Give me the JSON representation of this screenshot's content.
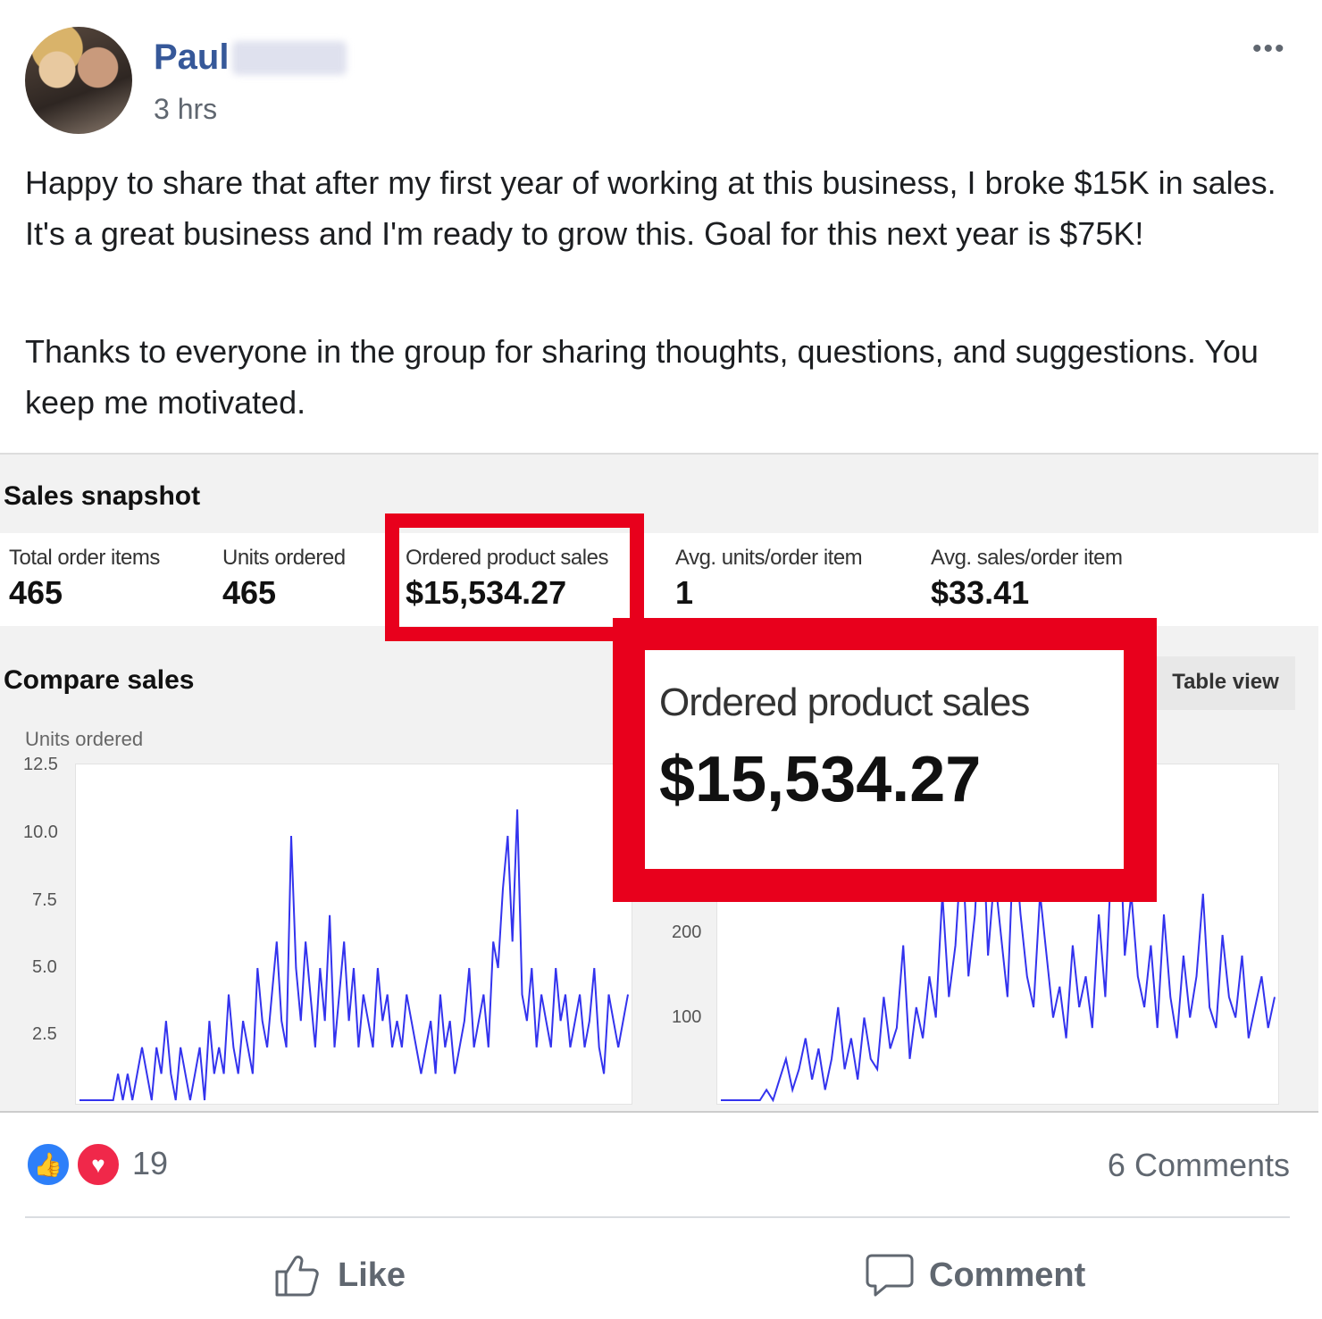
{
  "post": {
    "author": "Paul",
    "time": "3 hrs",
    "more_icon": "•••",
    "paragraphs": [
      "Happy to share that after my first year of working at this business, I broke $15K in sales. It's a great business and I'm ready to grow this. Goal for this next year is $75K!",
      "Thanks to everyone in the group for sharing thoughts, questions, and suggestions. You keep me motivated."
    ]
  },
  "screenshot": {
    "title": "Sales snapshot",
    "metrics": [
      {
        "label": "Total order items",
        "value": "465"
      },
      {
        "label": "Units ordered",
        "value": "465"
      },
      {
        "label": "Ordered product sales",
        "value": "$15,534.27"
      },
      {
        "label": "Avg. units/order item",
        "value": "1"
      },
      {
        "label": "Avg. sales/order item",
        "value": "$33.41"
      }
    ],
    "compare_title": "Compare sales",
    "units_label": "Units ordered",
    "table_view": "Table view",
    "zoom": {
      "label": "Ordered product sales",
      "value": "$15,534.27"
    },
    "highlight_color": "#e8001c"
  },
  "chart_data": [
    {
      "type": "line",
      "ylabel": "Units ordered",
      "ylim": [
        0,
        12.5
      ],
      "yticks": [
        "12.5",
        "10.0",
        "7.5",
        "5.0",
        "2.5"
      ],
      "series_color": "#3333ee",
      "values": [
        0,
        0,
        0,
        0,
        0,
        0,
        0,
        0,
        1,
        0,
        1,
        0,
        1,
        2,
        1,
        0,
        2,
        1,
        3,
        1,
        0,
        2,
        1,
        0,
        1,
        2,
        0,
        3,
        1,
        2,
        1,
        4,
        2,
        1,
        3,
        2,
        1,
        5,
        3,
        2,
        4,
        6,
        3,
        2,
        10,
        5,
        3,
        6,
        4,
        2,
        5,
        3,
        7,
        2,
        4,
        6,
        3,
        5,
        2,
        4,
        3,
        2,
        5,
        3,
        4,
        2,
        3,
        2,
        4,
        3,
        2,
        1,
        2,
        3,
        1,
        4,
        2,
        3,
        1,
        2,
        3,
        5,
        2,
        3,
        4,
        2,
        6,
        5,
        8,
        10,
        6,
        11,
        4,
        3,
        5,
        2,
        4,
        3,
        2,
        5,
        3,
        4,
        2,
        3,
        4,
        2,
        3,
        5,
        2,
        1,
        4,
        3,
        2,
        3,
        4
      ]
    },
    {
      "type": "line",
      "yticks": [
        "200",
        "100"
      ],
      "series_color": "#3333ee",
      "values": [
        0,
        0,
        0,
        0,
        0,
        0,
        0,
        10,
        0,
        20,
        40,
        10,
        30,
        60,
        20,
        50,
        10,
        40,
        90,
        30,
        60,
        20,
        80,
        40,
        30,
        100,
        50,
        70,
        150,
        40,
        90,
        60,
        120,
        80,
        200,
        100,
        150,
        250,
        120,
        180,
        300,
        140,
        220,
        160,
        100,
        260,
        180,
        120,
        90,
        200,
        140,
        80,
        110,
        60,
        150,
        90,
        120,
        70,
        180,
        100,
        240,
        300,
        140,
        200,
        120,
        90,
        150,
        70,
        180,
        100,
        60,
        140,
        80,
        120,
        200,
        90,
        70,
        160,
        100,
        80,
        140,
        60,
        90,
        120,
        70,
        100
      ]
    }
  ],
  "footer": {
    "like_icon": "👍",
    "love_icon": "♥",
    "reaction_count": "19",
    "comments": "6 Comments",
    "like_label": "Like",
    "comment_label": "Comment"
  }
}
